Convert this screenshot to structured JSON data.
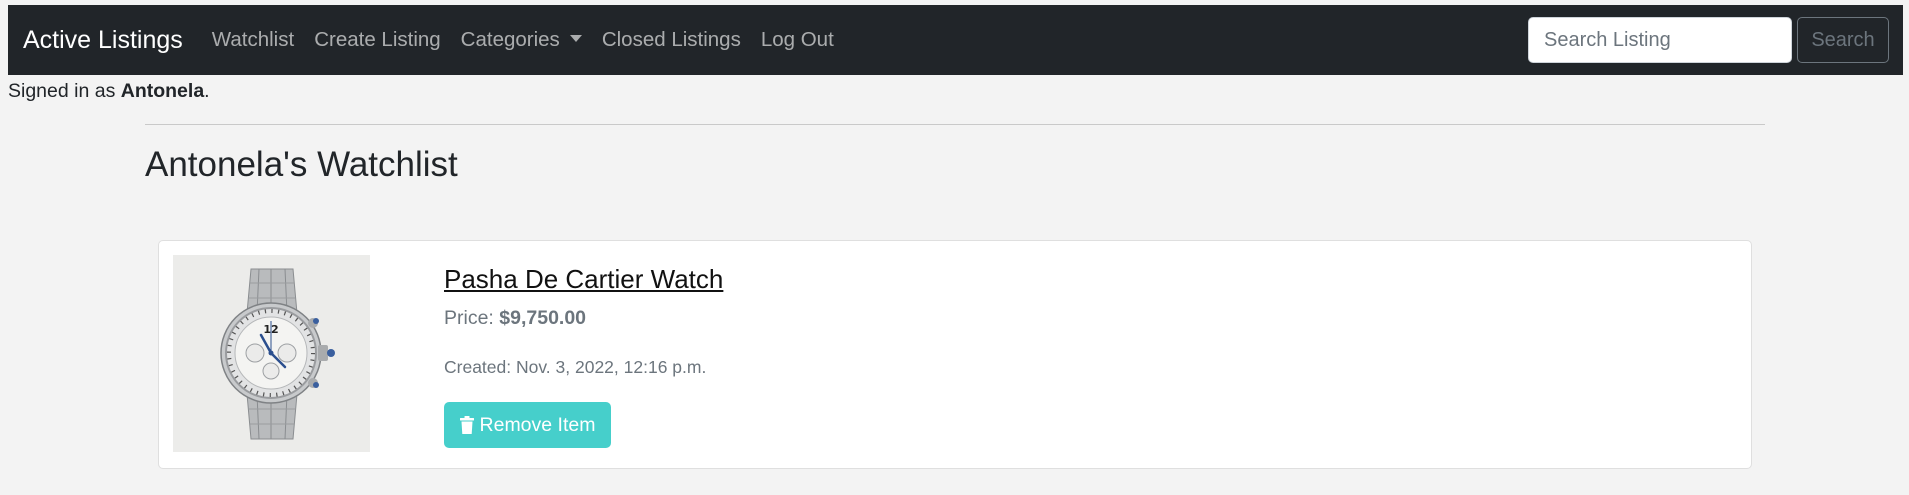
{
  "navbar": {
    "brand": "Active Listings",
    "links": [
      "Watchlist",
      "Create Listing",
      "Categories",
      "Closed Listings",
      "Log Out"
    ],
    "search_placeholder": "Search Listing",
    "search_button": "Search"
  },
  "signed_in": {
    "prefix": "Signed in as ",
    "username": "Antonela",
    "suffix": "."
  },
  "page": {
    "title": "Antonela's Watchlist"
  },
  "watchlist": {
    "items": [
      {
        "title": "Pasha De Cartier Watch",
        "price_label": "Price: ",
        "price_value": "$9,750.00",
        "created": "Created: Nov. 3, 2022, 12:16 p.m.",
        "remove_label": "Remove Item",
        "image_icon": "watch-image"
      }
    ]
  },
  "colors": {
    "navbar_bg": "#212529",
    "page_bg": "#f3f3f3",
    "remove_button": "#46cfcb",
    "muted_text": "#6c757d"
  }
}
